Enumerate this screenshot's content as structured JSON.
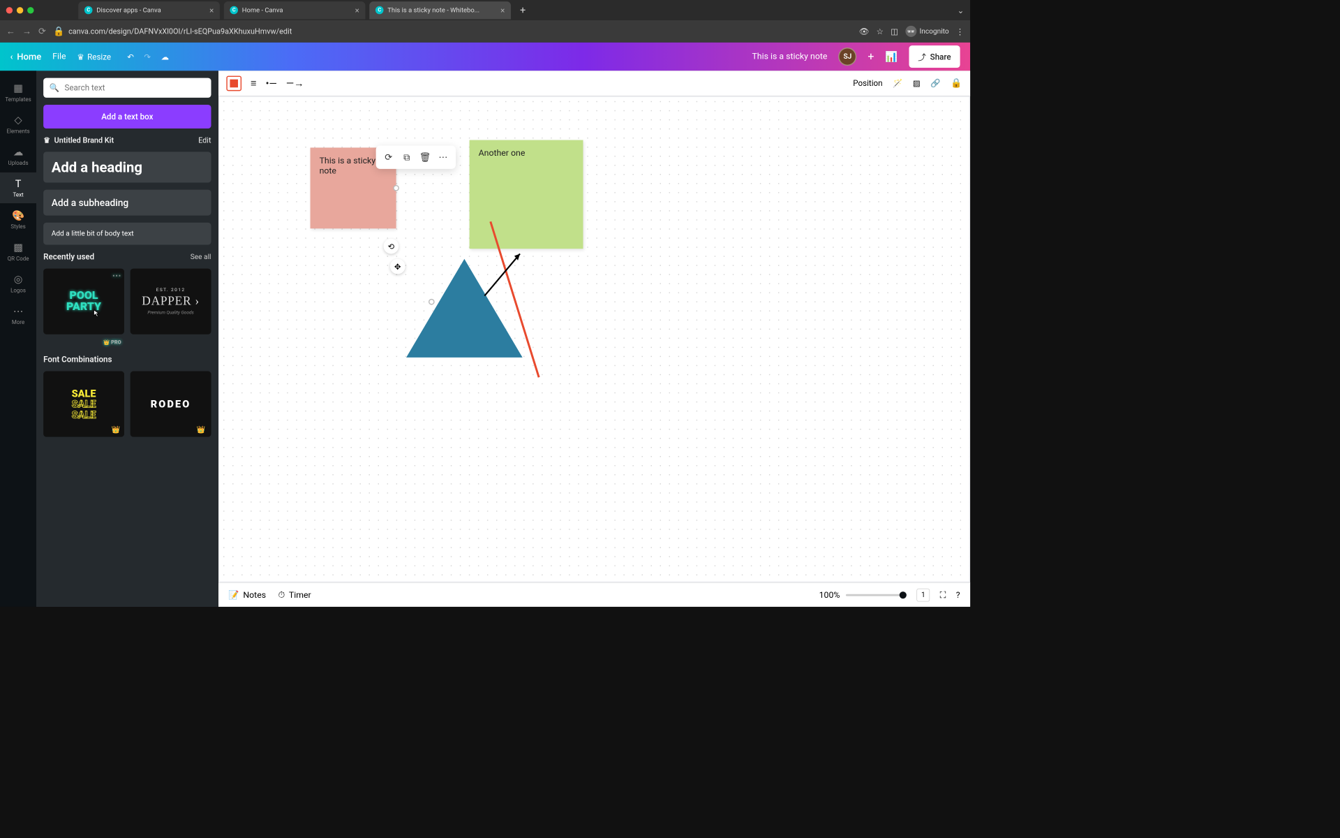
{
  "browser": {
    "tabs": [
      {
        "label": "Discover apps - Canva"
      },
      {
        "label": "Home - Canva"
      },
      {
        "label": "This is a sticky note - Whitebo..."
      }
    ],
    "url": "canva.com/design/DAFNVxXl0OI/rLl-sEQPua9aXKhuxuHmvw/edit",
    "incognito_label": "Incognito"
  },
  "appbar": {
    "home": "Home",
    "file": "File",
    "resize": "Resize",
    "title": "This is a sticky note",
    "avatar": "SJ",
    "share": "Share"
  },
  "rail": {
    "items": [
      {
        "label": "Templates"
      },
      {
        "label": "Elements"
      },
      {
        "label": "Uploads"
      },
      {
        "label": "Text"
      },
      {
        "label": "Styles"
      },
      {
        "label": "QR Code"
      },
      {
        "label": "Logos"
      },
      {
        "label": "More"
      }
    ]
  },
  "panel": {
    "search_placeholder": "Search text",
    "add_text_box": "Add a text box",
    "brand_kit": "Untitled Brand Kit",
    "edit": "Edit",
    "heading": "Add a heading",
    "subheading": "Add a subheading",
    "body": "Add a little bit of body text",
    "recently_used": "Recently used",
    "see_all": "See all",
    "font_combinations": "Font Combinations",
    "pro_badge": "PRO",
    "cards": {
      "pool1": "POOL",
      "pool2": "PARTY",
      "dapper_est": "EST. 2012",
      "dapper": "DAPPER ›",
      "dapper_sub": "Premium Quality Goods",
      "sale": "SALE",
      "rodeo": "RODEO"
    }
  },
  "canvas_toolbar": {
    "position": "Position"
  },
  "stickies": {
    "pink": "This is a sticky note",
    "green": "Another one"
  },
  "footer": {
    "notes": "Notes",
    "timer": "Timer",
    "zoom": "100%",
    "page": "1"
  },
  "colors": {
    "accent_red": "#e84a2e",
    "triangle": "#2c7da0",
    "sticky_pink": "#e8a79c",
    "sticky_green": "#c1e08a"
  }
}
